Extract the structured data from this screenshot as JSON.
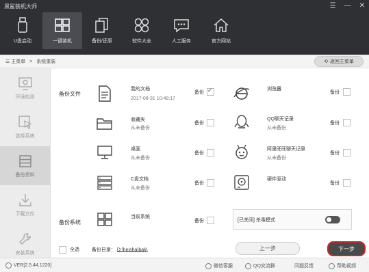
{
  "app": {
    "title": "黑鲨装机大师"
  },
  "nav": [
    {
      "label": "U盘启动",
      "icon": "usb-icon"
    },
    {
      "label": "一键装机",
      "icon": "windows-icon"
    },
    {
      "label": "备份/还原",
      "icon": "backup-icon"
    },
    {
      "label": "软件大全",
      "icon": "apps-icon"
    },
    {
      "label": "人工服务",
      "icon": "chat-icon"
    },
    {
      "label": "官方网站",
      "icon": "home-icon"
    }
  ],
  "breadcrumb": {
    "home": "主菜单",
    "sep": ">",
    "current": "系统重装"
  },
  "back_button": "返回主菜单",
  "sidebar": [
    {
      "label": "环境检测",
      "icon": "monitor-check-icon"
    },
    {
      "label": "选择系统",
      "icon": "cursor-icon"
    },
    {
      "label": "备份资料",
      "icon": "storage-icon"
    },
    {
      "label": "下载文件",
      "icon": "download-icon"
    },
    {
      "label": "安装系统",
      "icon": "wrench-icon"
    }
  ],
  "backup_files": {
    "section_label": "备份文件",
    "items": [
      {
        "name": "我的文档",
        "sub": "2017-08-31 10:48:17",
        "checkbox_label": "备份",
        "checked": true
      },
      {
        "name": "浏览器",
        "sub": "",
        "checkbox_label": "备份",
        "checked": false
      },
      {
        "name": "收藏夹",
        "sub": "从未备份",
        "checkbox_label": "备份",
        "checked": false
      },
      {
        "name": "QQ聊天记录",
        "sub": "从未备份",
        "checkbox_label": "备份",
        "checked": false
      },
      {
        "name": "桌面",
        "sub": "从未备份",
        "checkbox_label": "备份",
        "checked": false
      },
      {
        "name": "阿里旺旺聊天记录",
        "sub": "从未备份",
        "checkbox_label": "备份",
        "checked": false
      },
      {
        "name": "C盘文档",
        "sub": "从未备份",
        "checkbox_label": "备份",
        "checked": false
      },
      {
        "name": "硬件驱动",
        "sub": "",
        "checkbox_label": "备份",
        "checked": false
      }
    ]
  },
  "backup_system": {
    "section_label": "备份系统",
    "name": "当前系统",
    "checkbox_label": "备份",
    "antivirus_label": "[已关闭] 杀毒模式"
  },
  "footer_controls": {
    "select_all": "全选",
    "dir_label": "备份目录：",
    "dir_value": "D:\\heisha\\bak\\",
    "prev": "上一步",
    "next": "下一步"
  },
  "status": {
    "version": "VER[2.5.44.1220]",
    "wechat": "微信客服",
    "qq": "QQ交流群",
    "feedback": "问题反馈",
    "help": "帮助视频"
  },
  "colors": {
    "titlebar": "#2f3034",
    "accent_border": "#c62828"
  }
}
